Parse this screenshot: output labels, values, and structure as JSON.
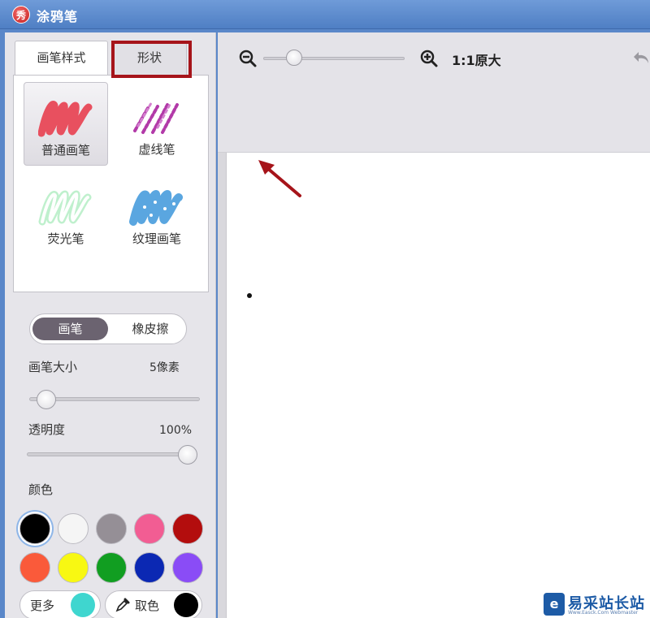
{
  "window": {
    "title": "涂鸦笔",
    "icon_char": "秀"
  },
  "tabs": {
    "brush_style": "画笔样式",
    "shape": "形状"
  },
  "brushes": [
    {
      "label": "普通画笔",
      "icon": "normal-brush-icon",
      "color": "#e8505f"
    },
    {
      "label": "虚线笔",
      "icon": "dashed-pen-icon",
      "color": "#b23aa8"
    },
    {
      "label": "荧光笔",
      "icon": "highlighter-icon",
      "color": "#9fe8b6"
    },
    {
      "label": "纹理画笔",
      "icon": "texture-brush-icon",
      "color": "#5aa6e0"
    }
  ],
  "mode": {
    "brush": "画笔",
    "eraser": "橡皮擦"
  },
  "brush_size": {
    "label": "画笔大小",
    "value": "5像素",
    "level": 0.05
  },
  "opacity": {
    "label": "透明度",
    "value": "100%",
    "level": 1.0
  },
  "colors": {
    "label": "颜色",
    "swatches": [
      "#000000",
      "#f5f5f5",
      "#958f96",
      "#f25d93",
      "#b30d0d",
      "#fa5a3a",
      "#f8f812",
      "#119e21",
      "#0b28b3",
      "#8a4cf6"
    ],
    "more_label": "更多",
    "more_color": "#3fd6cf",
    "picker_label": "取色",
    "picker_color": "#000000"
  },
  "zoom": {
    "label": "1:1原大",
    "level": 0.25
  },
  "watermark": {
    "text": "易采站长站",
    "icon_char": "e",
    "subtext": "Www.Easck.Com Webmaster"
  }
}
